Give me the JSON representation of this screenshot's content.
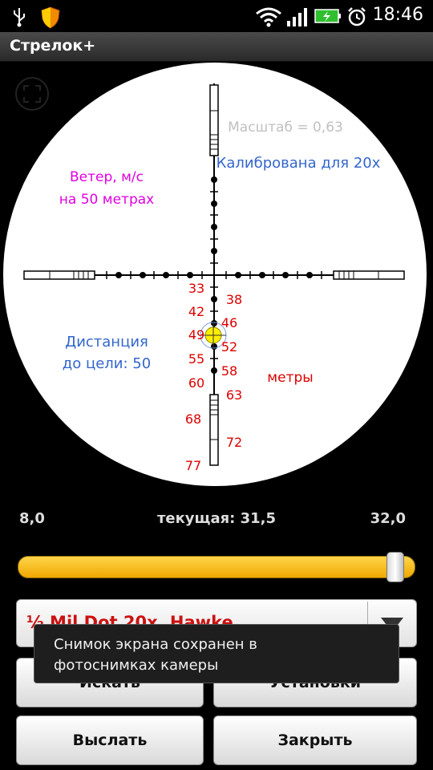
{
  "status_bar": {
    "time": "18:46",
    "icons": [
      "usb-icon",
      "shield-warning-icon",
      "wifi-icon",
      "signal-icon",
      "battery-charging-icon",
      "alarm-icon"
    ]
  },
  "app": {
    "title": "Стрелок+"
  },
  "scope": {
    "scale_label": "Масштаб = 0,63",
    "calibrated_label": "Калибрована для 20х",
    "wind_line1": "Ветер, м/с",
    "wind_line2": "на 50 метрах",
    "distance_line1": "Дистанция",
    "distance_line2": "до цели: 50",
    "units_label": "метры",
    "range_marks_left": [
      "33",
      "42",
      "49",
      "55",
      "60",
      "68",
      "77"
    ],
    "range_marks_right": [
      "38",
      "46",
      "52",
      "58",
      "63",
      "72"
    ],
    "colors": {
      "wind": "#e000e0",
      "info": "#3366cc",
      "marks": "#dd0000",
      "scale": "#c0c0c0",
      "target": "#ffee00"
    }
  },
  "zoom": {
    "min": "8,0",
    "current": "текущая: 31,5",
    "max": "32,0",
    "slider_fraction": 0.97
  },
  "reticle_select": {
    "value": "½ Mil Dot 20x, Hawke"
  },
  "buttons": {
    "search": "Искать",
    "settings": "Установки",
    "send": "Выслать",
    "close": "Закрыть"
  },
  "toast": {
    "line1": "Снимок экрана сохранен в",
    "line2": "фотоснимках камеры"
  }
}
